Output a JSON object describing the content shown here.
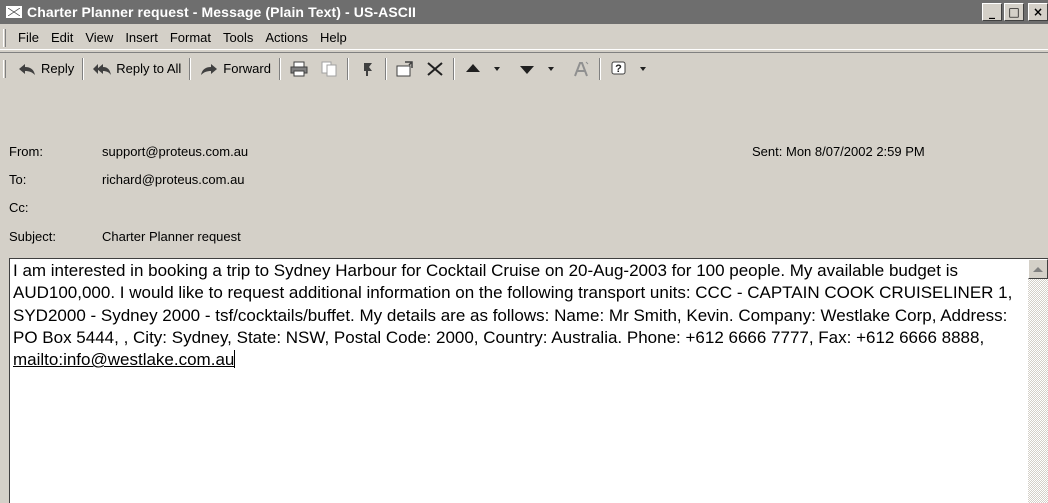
{
  "window": {
    "title": "Charter Planner request - Message (Plain Text) - US-ASCII",
    "minimize": "_",
    "maximize": "□",
    "close": "×"
  },
  "menu": [
    {
      "label": "File"
    },
    {
      "label": "Edit"
    },
    {
      "label": "View"
    },
    {
      "label": "Insert"
    },
    {
      "label": "Format"
    },
    {
      "label": "Tools"
    },
    {
      "label": "Actions"
    },
    {
      "label": "Help"
    }
  ],
  "toolbar": {
    "reply": "Reply",
    "reply_all": "Reply to All",
    "forward": "Forward"
  },
  "headers": {
    "from_label": "From:",
    "from_value": "support@proteus.com.au",
    "to_label": "To:",
    "to_value": "richard@proteus.com.au",
    "cc_label": "Cc:",
    "cc_value": "",
    "subject_label": "Subject:",
    "subject_value": "Charter Planner request",
    "sent_label": "Sent:",
    "sent_value": "Mon 8/07/2002 2:59 PM"
  },
  "body": {
    "text": "I am interested in booking a trip to Sydney Harbour for Cocktail Cruise on 20-Aug-2003 for 100 people. My available budget is AUD100,000. I would like to request additional information on the following transport units: CCC - CAPTAIN COOK CRUISELINER 1, SYD2000 - Sydney 2000 - tsf/cocktails/buffet. My details are as follows: Name: Mr Smith, Kevin. Company: Westlake Corp, Address: PO Box 5444, , City: Sydney, State: NSW, Postal Code: 2000, Country: Australia. Phone: +612 6666 7777, Fax: +612 6666 8888, ",
    "link": "mailto:info@westlake.com.au"
  }
}
